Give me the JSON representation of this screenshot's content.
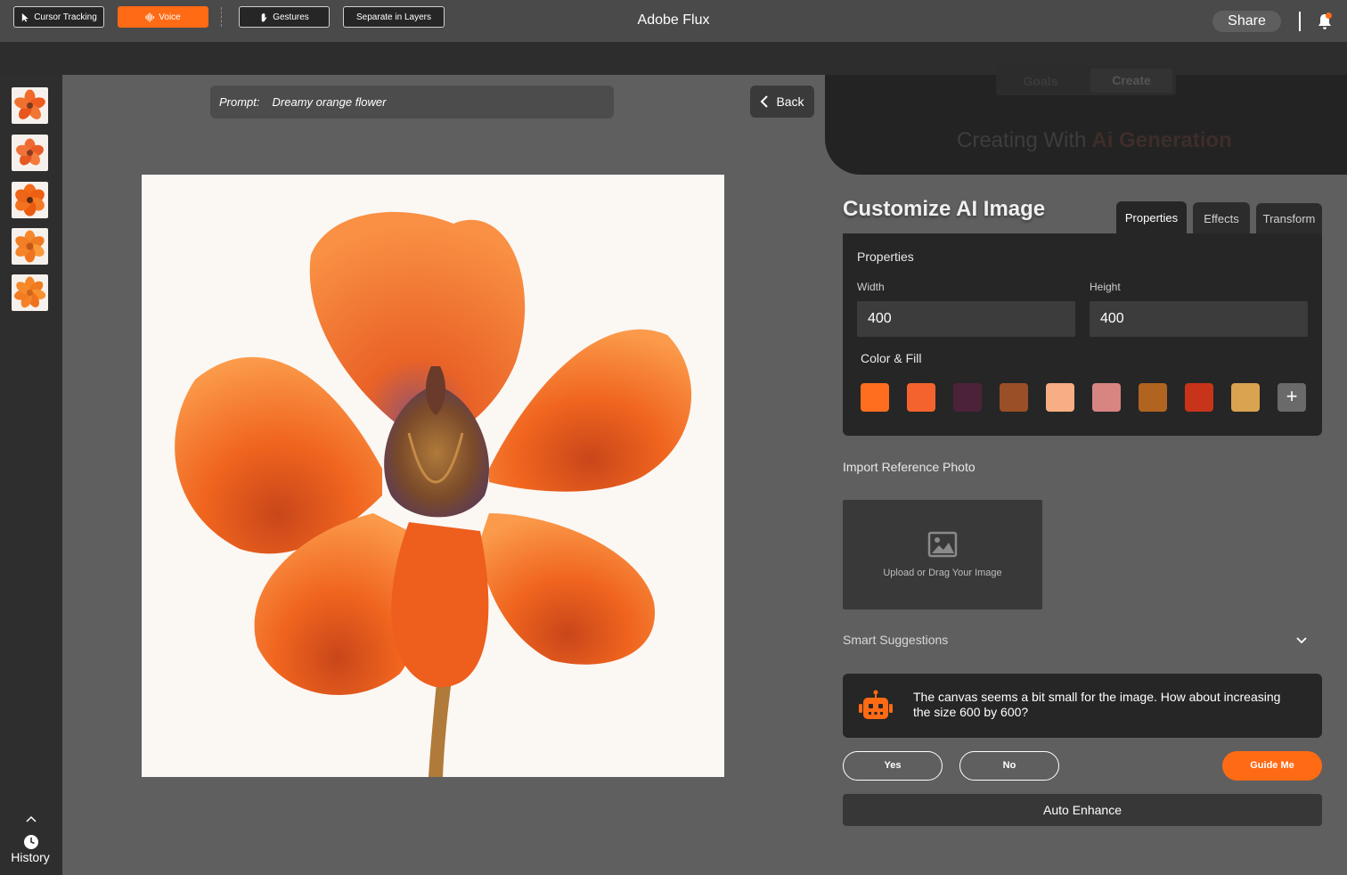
{
  "app": {
    "title": "Adobe Flux",
    "share_label": "Share"
  },
  "toolbar": {
    "cursor_tracking": "Cursor Tracking",
    "voice": "Voice",
    "gestures": "Gestures",
    "separate_layers": "Separate in Layers"
  },
  "sidebar": {
    "history_label": "History"
  },
  "prompt": {
    "label": "Prompt:",
    "value": "Dreamy orange flower"
  },
  "back_label": "Back",
  "mode_tabs": {
    "goals": "Goals",
    "create": "Create"
  },
  "creating": {
    "prefix": "Creating With",
    "highlight": "Ai Generation"
  },
  "customize": {
    "title": "Customize AI Image",
    "tabs": [
      "Properties",
      "Effects",
      "Transform"
    ],
    "properties_heading": "Properties",
    "width_label": "Width",
    "width_value": "400",
    "height_label": "Height",
    "height_value": "400",
    "color_fill_label": "Color & Fill",
    "swatches": [
      "#ff6d1f",
      "#f4632d",
      "#4b2238",
      "#9a4f26",
      "#f7ae84",
      "#d88582",
      "#b0641f",
      "#c8341a",
      "#d9a34f"
    ],
    "add_symbol": "+"
  },
  "import": {
    "label": "Import Reference Photo",
    "upload_text": "Upload or Drag Your Image"
  },
  "smart": {
    "label": "Smart Suggestions",
    "message": "The canvas seems a bit small for the image. How about increasing the size 600 by 600?",
    "yes": "Yes",
    "no": "No",
    "guide": "Guide Me"
  },
  "auto_enhance": "Auto Enhance",
  "colors": {
    "accent": "#ff6a14"
  }
}
